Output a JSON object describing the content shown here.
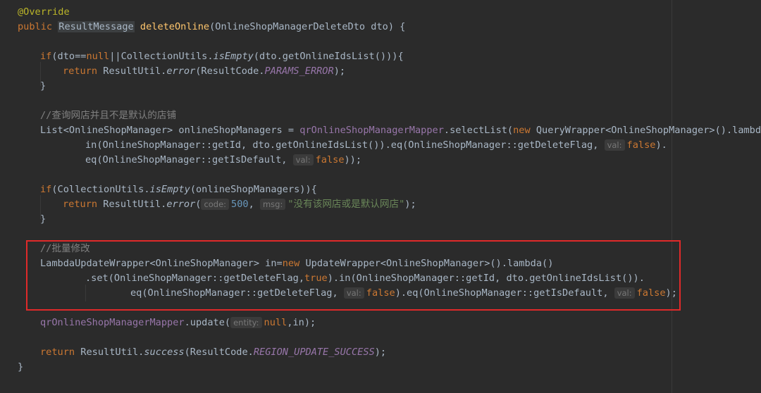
{
  "code": {
    "annotation": "@Override",
    "l1": {
      "kw_public": "public",
      "ret_type": "ResultMessage",
      "method": "deleteOnline",
      "params": "(OnlineShopManagerDeleteDto dto) {"
    },
    "l3": {
      "kw_if": "if",
      "p1": "(dto==",
      "kw_null": "null",
      "p2": "||CollectionUtils.",
      "is_empty": "isEmpty",
      "p3": "(dto.getOnlineIdsList())){"
    },
    "l4": {
      "kw_return": "return",
      "p1": " ResultUtil.",
      "error": "error",
      "p2": "(ResultCode.",
      "field": "PARAMS_ERROR",
      "p3": ");"
    },
    "close_brace": "}",
    "comment1": "//查询网店并且不是默认的店铺",
    "l7": {
      "p1": "List<OnlineShopManager> onlineShopManagers = ",
      "mapper": "qrOnlineShopManagerMapper",
      "p2": ".selectList(",
      "kw_new": "new",
      "p3": " QueryWrapper<OnlineShopManager>().lambda()"
    },
    "l8": {
      "p1": "in(OnlineShopManager::getId, dto.getOnlineIdsList()).eq(OnlineShopManager::getDeleteFlag, ",
      "hint_val": "val:",
      "kw_false": "false",
      "p2": ")."
    },
    "l9": {
      "p1": "eq(OnlineShopManager::getIsDefault, ",
      "hint_val": "val:",
      "kw_false": "false",
      "p2": "));"
    },
    "l11": {
      "kw_if": "if",
      "p1": "(CollectionUtils.",
      "is_empty": "isEmpty",
      "p2": "(onlineShopManagers)){"
    },
    "l12": {
      "kw_return": "return",
      "p1": " ResultUtil.",
      "error": "error",
      "p2": "(",
      "hint_code": "code:",
      "num": "500",
      "p3": ", ",
      "hint_msg": "msg:",
      "str": "\"没有该网店或是默认网店\"",
      "p4": ");"
    },
    "comment2": "//批量修改",
    "l16": {
      "p1": "LambdaUpdateWrapper<OnlineShopManager> in=",
      "kw_new": "new",
      "p2": " UpdateWrapper<OnlineShopManager>().lambda()"
    },
    "l17": {
      "p1": ".set(OnlineShopManager::getDeleteFlag,",
      "kw_true": "true",
      "p2": ").in(OnlineShopManager::getId, dto.getOnlineIdsList())."
    },
    "l18": {
      "p1": "eq(OnlineShopManager::getDeleteFlag, ",
      "hint_val1": "val:",
      "kw_false1": "false",
      "p2": ").eq(OnlineShopManager::getIsDefault, ",
      "hint_val2": "val:",
      "kw_false2": "false",
      "p3": ");"
    },
    "l20": {
      "mapper": "qrOnlineShopManagerMapper",
      "p1": ".update(",
      "hint_entity": "entity:",
      "kw_null": "null",
      "p2": ",in);"
    },
    "l22": {
      "kw_return": "return",
      "p1": " ResultUtil.",
      "success": "success",
      "p2": "(ResultCode.",
      "field": "REGION_UPDATE_SUCCESS",
      "p3": ");"
    }
  },
  "colors": {
    "background": "#2b2b2b",
    "keyword": "#cc7832",
    "annotation": "#bbb529",
    "method_decl": "#ffc66d",
    "field": "#9876aa",
    "number": "#6897bb",
    "string": "#6a8759",
    "comment": "#808080",
    "selection_border": "#e02a2a"
  }
}
